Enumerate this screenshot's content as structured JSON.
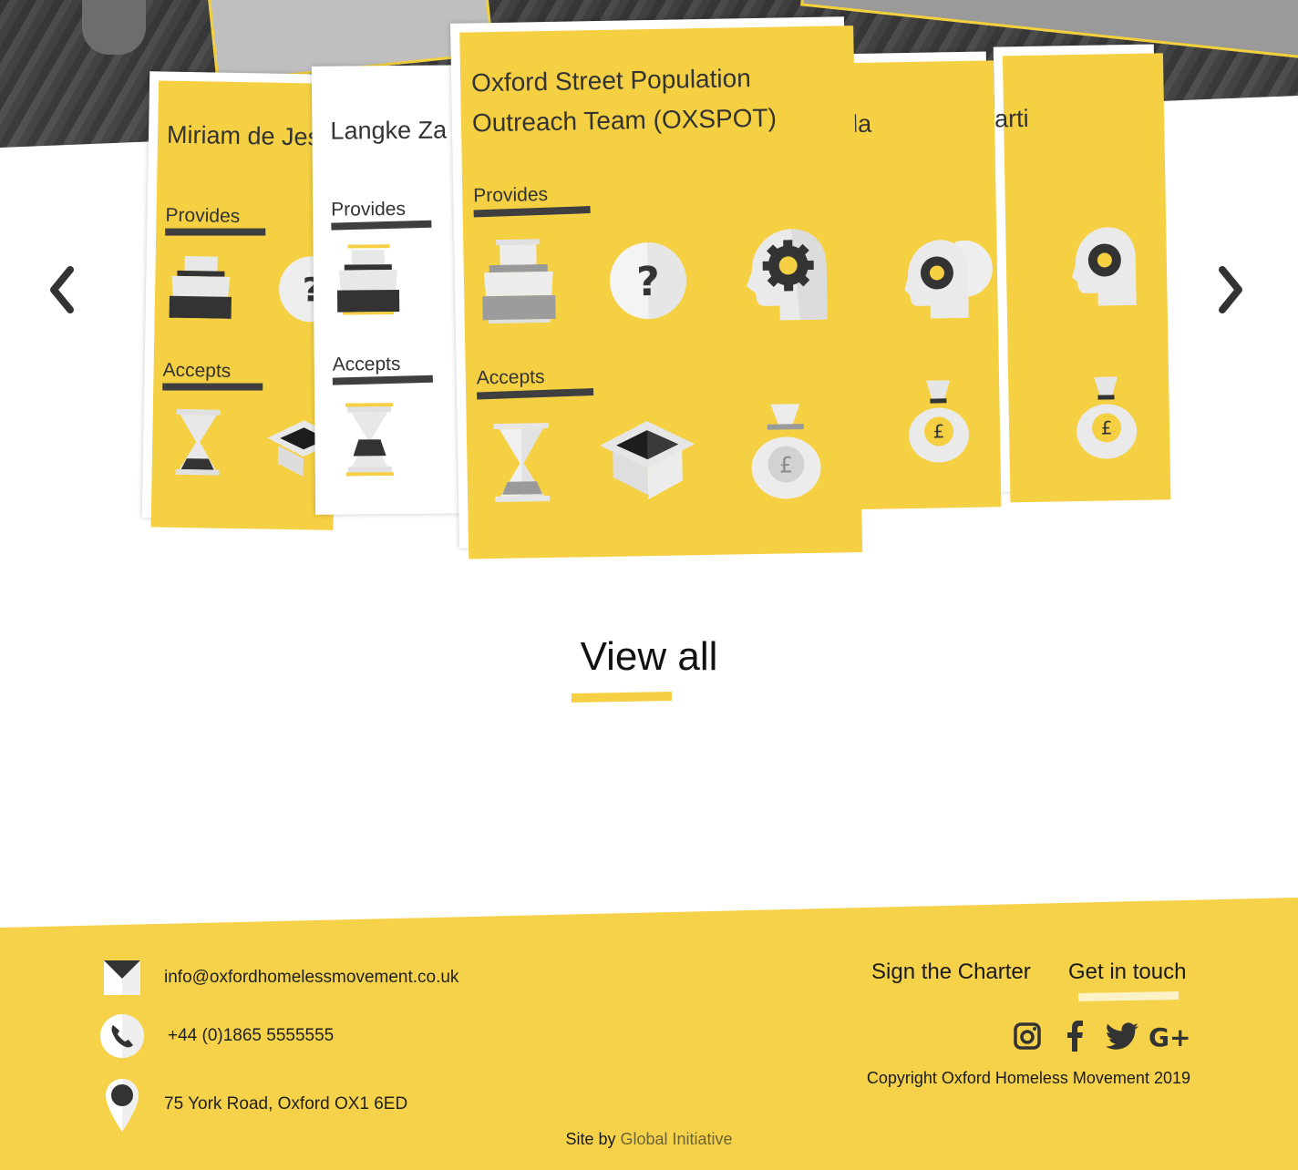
{
  "carousel": {
    "cards": [
      {
        "title": "Miriam de Jes",
        "provides_label": "Provides",
        "accepts_label": "Accepts"
      },
      {
        "title": "Langke Za",
        "provides_label": "Provides",
        "accepts_label": "Accepts"
      },
      {
        "title": "Oxford Street Population",
        "title_line2": "Outreach Team (OXSPOT)",
        "provides_label": "Provides",
        "accepts_label": "Accepts"
      },
      {
        "title": "ndla"
      },
      {
        "title": "arti"
      }
    ],
    "prev_icon": "chevron-left-icon",
    "next_icon": "chevron-right-icon"
  },
  "view_all": {
    "label": "View all"
  },
  "footer": {
    "email": "info@oxfordhomelessmovement.co.uk",
    "phone": "+44 (0)1865 5555555",
    "address": "75 York Road, Oxford OX1 6ED",
    "nav": {
      "charter": "Sign the Charter",
      "contact": "Get in touch"
    },
    "social": [
      "instagram-icon",
      "facebook-icon",
      "twitter-icon",
      "google-plus-icon"
    ],
    "copyright": "Copyright Oxford Homeless Movement 2019",
    "site_by_prefix": "Site by",
    "site_by_link": "Global Initiative"
  },
  "colors": {
    "accent": "#f5d043",
    "dark": "#333333",
    "footer_bg": "#f6d24b"
  }
}
